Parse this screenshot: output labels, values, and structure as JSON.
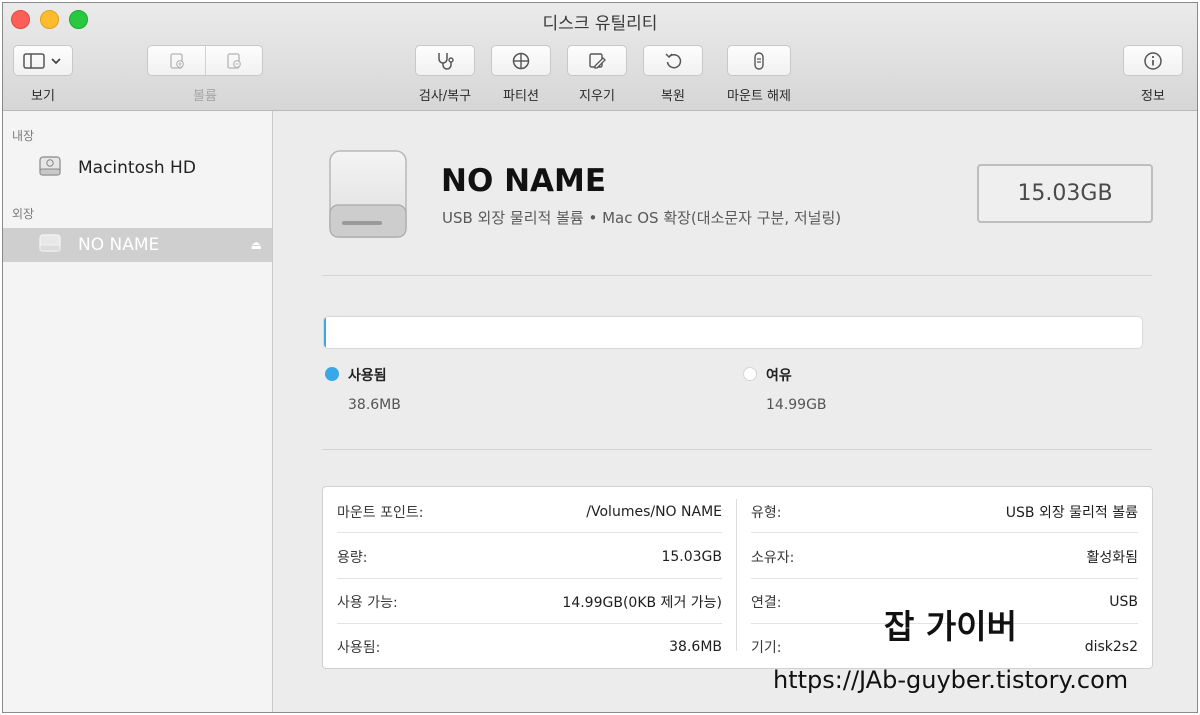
{
  "window": {
    "title": "디스크 유틸리티"
  },
  "toolbar": {
    "view_label": "보기",
    "volume_label": "볼륨",
    "first_aid_label": "검사/복구",
    "partition_label": "파티션",
    "erase_label": "지우기",
    "restore_label": "복원",
    "unmount_label": "마운트 해제",
    "info_label": "정보"
  },
  "sidebar": {
    "internal_header": "내장",
    "external_header": "외장",
    "items": [
      {
        "label": "Macintosh HD",
        "icon": "internal-disk-icon",
        "selected": false
      },
      {
        "label": "NO NAME",
        "icon": "external-disk-icon",
        "selected": true,
        "ejectable": true
      }
    ]
  },
  "volume": {
    "name": "NO NAME",
    "subtitle": "USB 외장 물리적 볼륨 • Mac OS 확장(대소문자 구분, 저널링)",
    "size": "15.03GB",
    "used_fraction": 0.0026,
    "used_label": "사용됨",
    "used_value": "38.6MB",
    "free_label": "여유",
    "free_value": "14.99GB",
    "used_color": "#3aa7e8",
    "free_color": "#ffffff"
  },
  "info": {
    "left": [
      {
        "key": "마운트 포인트:",
        "value": "/Volumes/NO NAME"
      },
      {
        "key": "용량:",
        "value": "15.03GB"
      },
      {
        "key": "사용 가능:",
        "value": "14.99GB(0KB 제거 가능)"
      },
      {
        "key": "사용됨:",
        "value": "38.6MB"
      }
    ],
    "right": [
      {
        "key": "유형:",
        "value": "USB 외장 물리적 볼륨"
      },
      {
        "key": "소유자:",
        "value": "활성화됨"
      },
      {
        "key": "연결:",
        "value": "USB"
      },
      {
        "key": "기기:",
        "value": "disk2s2"
      }
    ]
  },
  "watermark": {
    "name": "잡 가이버",
    "url": "https://JAb-guyber.tistory.com"
  }
}
